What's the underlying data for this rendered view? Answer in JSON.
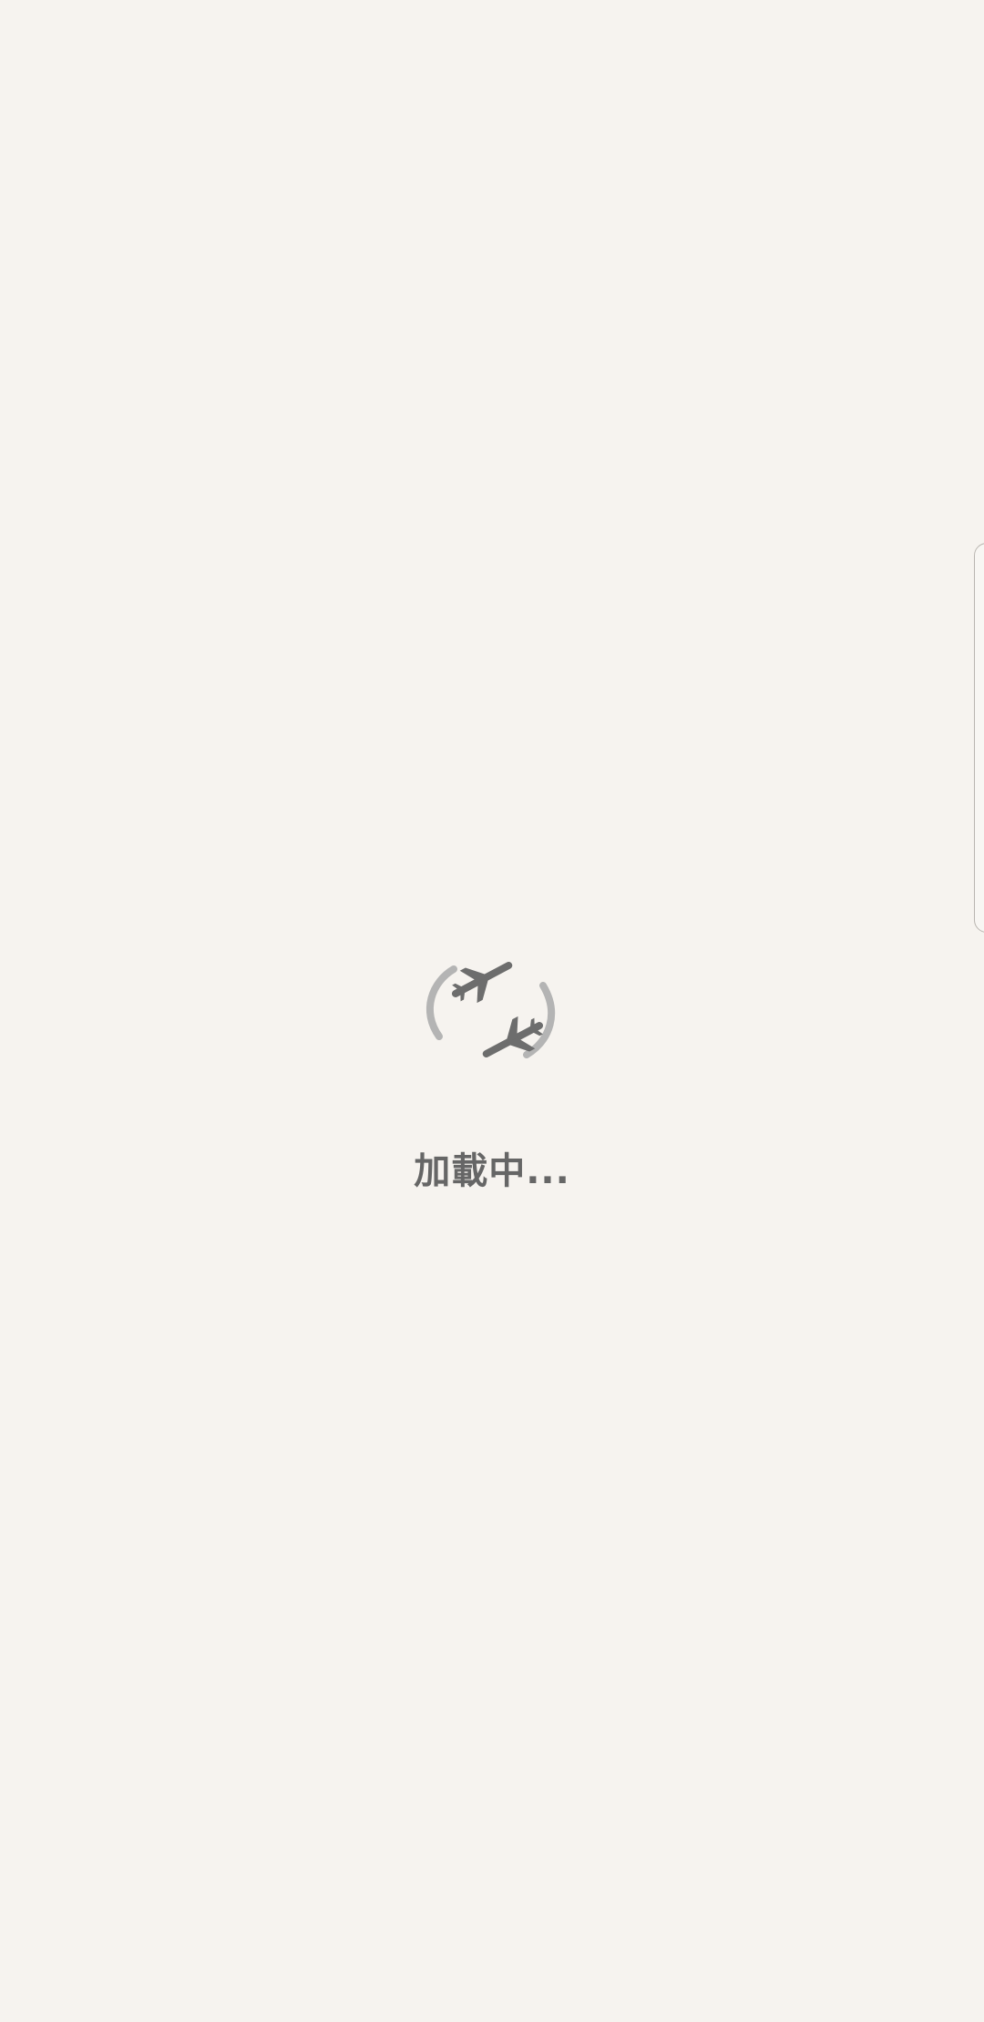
{
  "loading": {
    "text": "加載中..."
  },
  "icons": {
    "spinner": "airplane-spinner-icon",
    "edge_handle": "edge-panel-handle"
  },
  "colors": {
    "background": "#f6f3ef",
    "text": "#666666",
    "plane": "#6d6d6d",
    "arc": "#b0b0b0"
  }
}
